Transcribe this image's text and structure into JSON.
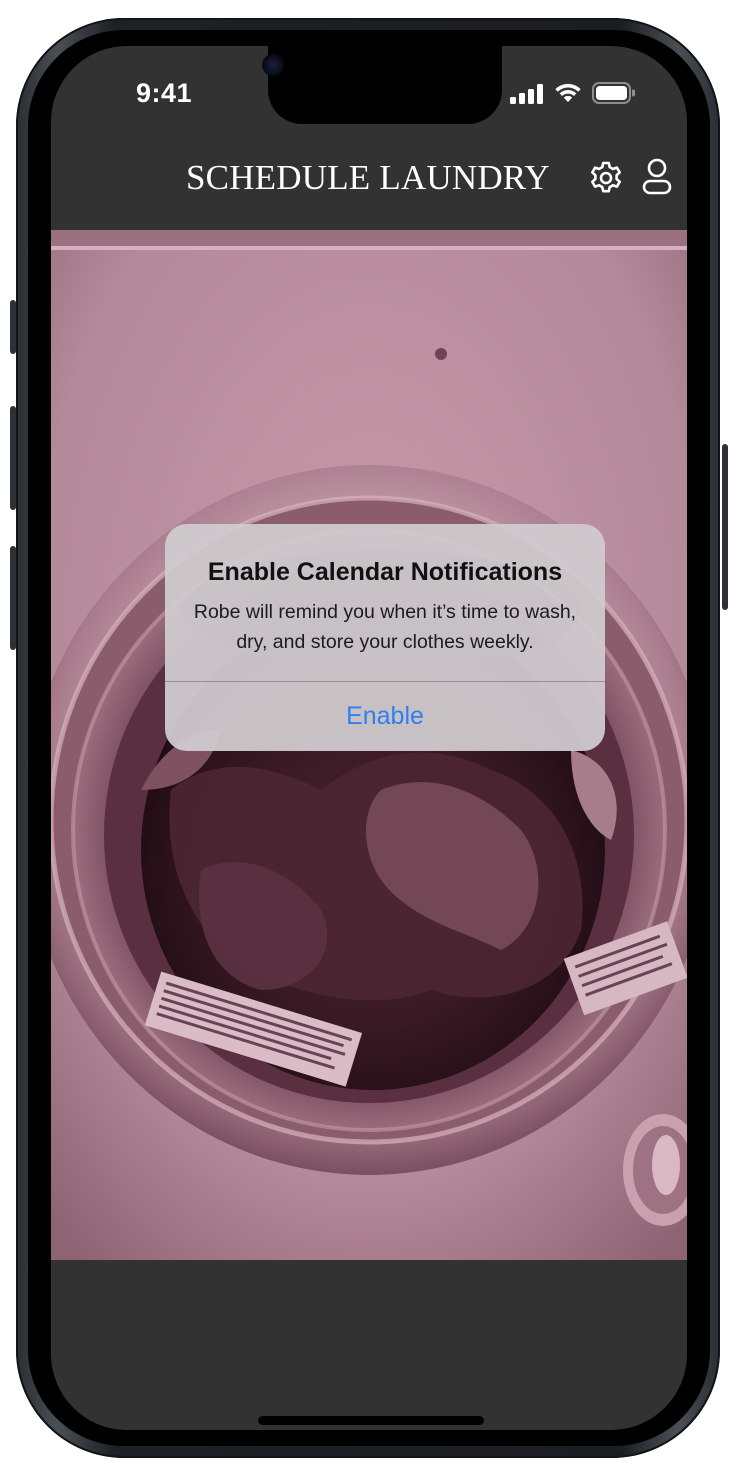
{
  "status_bar": {
    "time": "9:41",
    "icons": [
      "cellular-signal-icon",
      "wifi-icon",
      "battery-icon"
    ]
  },
  "header": {
    "title": "SCHEDULE LAUNDRY",
    "actions": [
      {
        "name": "settings-button",
        "icon": "gear-icon"
      },
      {
        "name": "profile-button",
        "icon": "person-icon"
      }
    ]
  },
  "background": {
    "tint": "#8a5a6b"
  },
  "alert": {
    "title": "Enable Calendar Notifications",
    "message": "Robe will remind you when it’s time to wash, dry, and store your clothes weekly.",
    "action_label": "Enable"
  },
  "colors": {
    "screen_bg": "#323232",
    "action_blue": "#2f7ff0",
    "header_text": "#ffffff"
  }
}
